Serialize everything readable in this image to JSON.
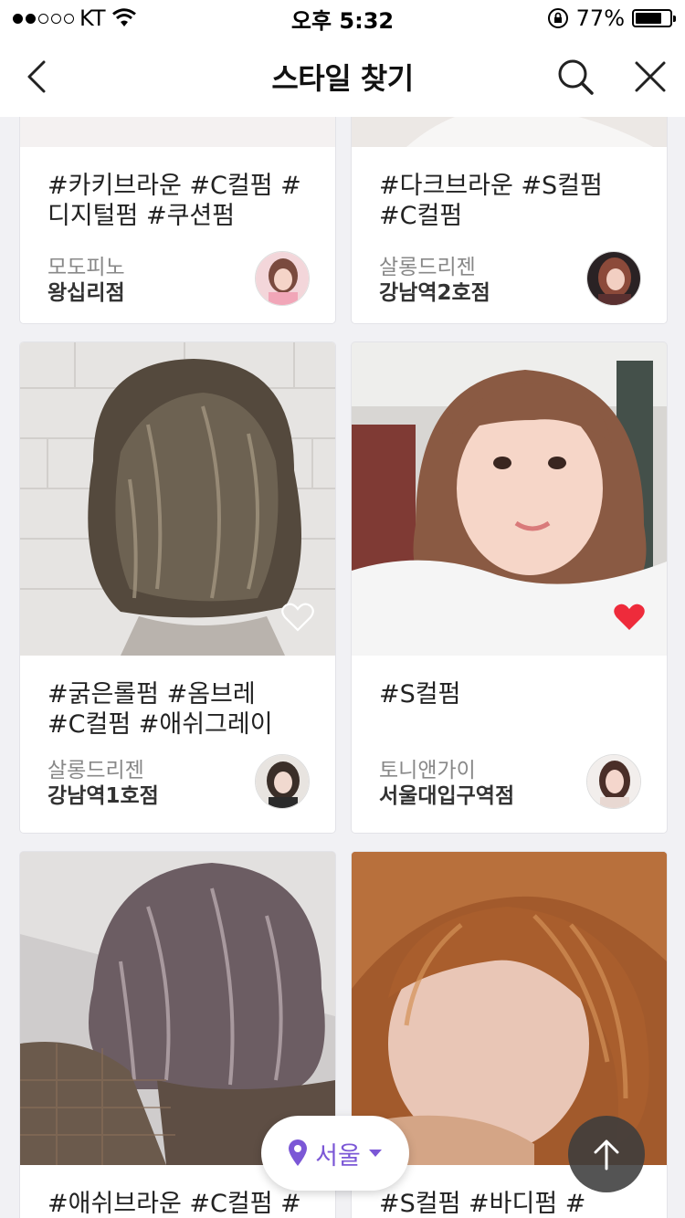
{
  "status_bar": {
    "carrier": "KT",
    "time": "오후 5:32",
    "battery": "77%",
    "battery_level": 0.77
  },
  "nav": {
    "title": "스타일 찾기"
  },
  "cards": [
    {
      "tags": "#카키브라운 #C컬펌 #디지털펌 #쿠션펌",
      "salon": "모도피노",
      "branch": "왕십리점",
      "liked": false
    },
    {
      "tags": "#다크브라운 #S컬펌 #C컬펌",
      "salon": "살롱드리젠",
      "branch": "강남역2호점",
      "liked": false
    },
    {
      "tags": "#굵은롤펌 #옴브레 #C컬펌 #애쉬그레이",
      "salon": "살롱드리젠",
      "branch": "강남역1호점",
      "liked": false
    },
    {
      "tags": "#S컬펌",
      "salon": "토니앤가이",
      "branch": "서울대입구역점",
      "liked": true
    },
    {
      "tags": "#애쉬브라운 #C컬펌 #볼",
      "salon": "",
      "branch": "",
      "liked": false
    },
    {
      "tags": "#S컬펌 #바디펌 #애쉬브",
      "salon": "",
      "branch": "",
      "liked": false
    }
  ],
  "location": {
    "label": "서울"
  },
  "icons": {
    "back": "chevron-left-icon",
    "search": "search-icon",
    "close": "close-icon",
    "location": "map-pin-icon",
    "dropdown": "caret-down-icon",
    "scroll_top": "arrow-up-icon",
    "heart": "heart-icon"
  },
  "colors": {
    "accent": "#7b57d6",
    "heart_active": "#ee2b3b"
  }
}
